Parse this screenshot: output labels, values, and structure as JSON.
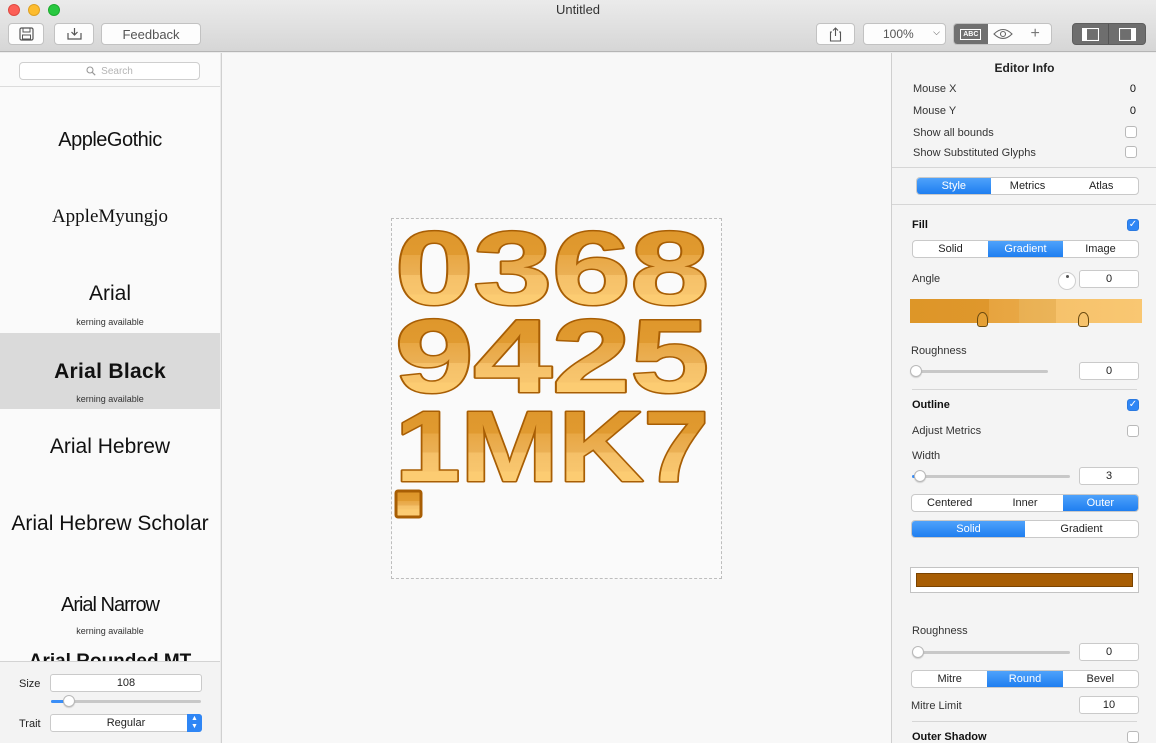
{
  "window": {
    "title": "Untitled"
  },
  "toolbar": {
    "save_icon": "save-icon",
    "export_icon": "export-icon",
    "feedback_label": "Feedback",
    "share_icon": "share-icon",
    "zoom_value": "100%",
    "abc_label": "ABC",
    "eye_icon": "eye-icon",
    "plus_label": "+"
  },
  "sidebar": {
    "search_placeholder": "Search",
    "fonts": [
      {
        "name": "AppleGothic",
        "kerning": ""
      },
      {
        "name": "AppleMyungjo",
        "kerning": ""
      },
      {
        "name": "Arial",
        "kerning": "kerning available"
      },
      {
        "name": "Arial Black",
        "kerning": "kerning available",
        "selected": true
      },
      {
        "name": "Arial Hebrew",
        "kerning": ""
      },
      {
        "name": "Arial Hebrew Scholar",
        "kerning": ""
      },
      {
        "name": "Arial Narrow",
        "kerning": "kerning available"
      },
      {
        "name": "Arial Rounded MT",
        "kerning": ""
      }
    ],
    "size_label": "Size",
    "size_value": "108",
    "size_slider": 0.12,
    "trait_label": "Trait",
    "trait_value": "Regular"
  },
  "canvas": {
    "rows": [
      "0368",
      "9425",
      "1MK7"
    ],
    "fill_colors": {
      "light": "#fccb70",
      "dark": "#de9428",
      "outline": "#a85e04"
    }
  },
  "editor_info": {
    "title": "Editor Info",
    "mouse_x_label": "Mouse X",
    "mouse_x_value": "0",
    "mouse_y_label": "Mouse Y",
    "mouse_y_value": "0",
    "show_bounds_label": "Show all bounds",
    "show_substituted_label": "Show Substituted Glyphs"
  },
  "tabs": [
    "Style",
    "Metrics",
    "Atlas"
  ],
  "fill": {
    "label": "Fill",
    "modes": [
      "Solid",
      "Gradient",
      "Image"
    ],
    "angle_label": "Angle",
    "angle_value": "0",
    "roughness_label": "Roughness",
    "roughness_value": "0"
  },
  "outline": {
    "label": "Outline",
    "adjust_metrics_label": "Adjust Metrics",
    "width_label": "Width",
    "width_value": "3",
    "width_slider": 0.05,
    "positions": [
      "Centered",
      "Inner",
      "Outer"
    ],
    "styles": [
      "Solid",
      "Gradient"
    ],
    "color": "#a85e04",
    "roughness_label": "Roughness",
    "roughness_value": "0",
    "joins": [
      "Mitre",
      "Round",
      "Bevel"
    ],
    "mitre_limit_label": "Mitre Limit",
    "mitre_limit_value": "10"
  },
  "outer_shadow": {
    "label": "Outer Shadow"
  }
}
